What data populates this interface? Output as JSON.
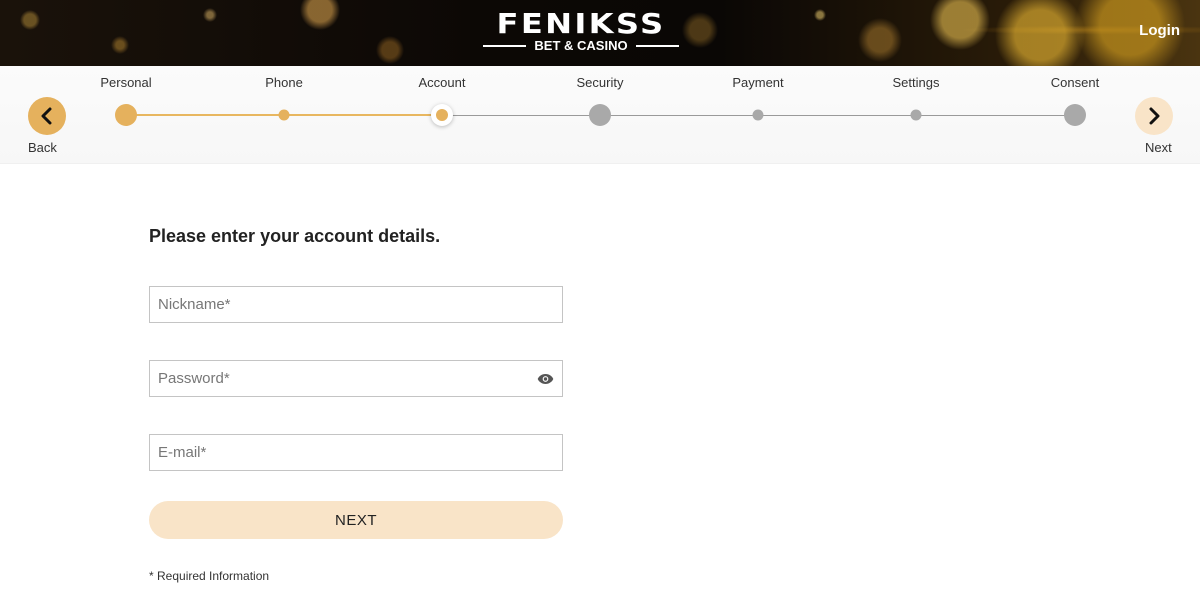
{
  "header": {
    "logo_main": "FENIKSS",
    "logo_sub": "BET & CASINO",
    "login_label": "Login"
  },
  "stepper": {
    "back_label": "Back",
    "next_label": "Next",
    "current_step": 3,
    "steps": [
      {
        "label": "Personal",
        "state": "done",
        "size": "big"
      },
      {
        "label": "Phone",
        "state": "done",
        "size": "small"
      },
      {
        "label": "Account",
        "state": "current",
        "size": "big"
      },
      {
        "label": "Security",
        "state": "todo",
        "size": "big"
      },
      {
        "label": "Payment",
        "state": "todo",
        "size": "small"
      },
      {
        "label": "Settings",
        "state": "todo",
        "size": "small"
      },
      {
        "label": "Consent",
        "state": "todo",
        "size": "big"
      }
    ]
  },
  "form": {
    "heading": "Please enter your account details.",
    "nickname": {
      "placeholder": "Nickname*",
      "value": ""
    },
    "password": {
      "placeholder": "Password*",
      "value": ""
    },
    "email": {
      "placeholder": "E-mail*",
      "value": ""
    },
    "submit_label": "NEXT",
    "required_note": "* Required Information"
  },
  "colors": {
    "accent": "#e5b15d",
    "accent_light": "#f9e4c8",
    "inactive": "#a9a9a9"
  }
}
